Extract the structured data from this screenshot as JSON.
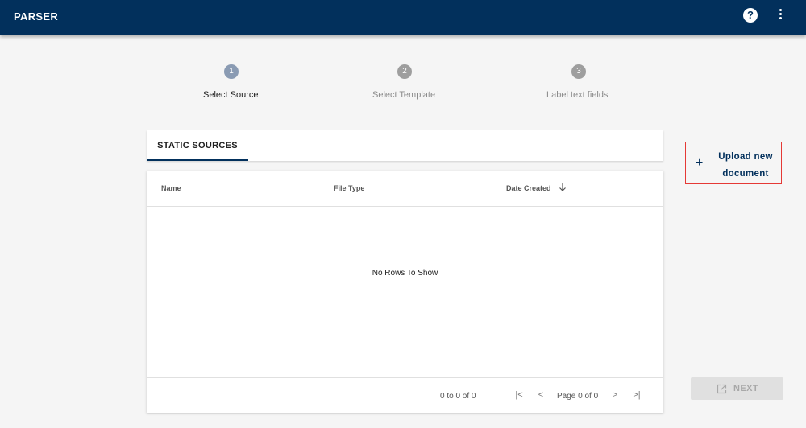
{
  "app": {
    "title": "PARSER",
    "help_glyph": "?",
    "help_icon": "help-icon",
    "menu_icon": "more-vert-icon"
  },
  "stepper": {
    "steps": [
      {
        "number": "1",
        "label": "Select Source",
        "state": "active"
      },
      {
        "number": "2",
        "label": "Select Template",
        "state": "inactive"
      },
      {
        "number": "3",
        "label": "Label text fields",
        "state": "inactive"
      }
    ]
  },
  "tabs": [
    {
      "label": "STATIC SOURCES",
      "selected": true
    }
  ],
  "grid": {
    "columns": [
      {
        "label": "Name"
      },
      {
        "label": "File Type"
      },
      {
        "label": "Date Created",
        "sort": "descending"
      }
    ],
    "rows": [],
    "empty_message": "No Rows To Show",
    "footer": {
      "row_count": "0 to 0 of 0",
      "page_info": "Page 0 of 0",
      "first_glyph": "|<",
      "prev_glyph": "<",
      "next_glyph": ">",
      "last_glyph": ">|"
    }
  },
  "upload": {
    "plus_glyph": "+",
    "label": "Upload new document",
    "icon": "plus-icon"
  },
  "next_button": {
    "label": "NEXT",
    "icon": "open-in-new-icon",
    "disabled": true
  },
  "colors": {
    "appbar": "#02305c",
    "accent": "#02305c",
    "highlight_border": "#e53935",
    "background": "#f5f5f5"
  }
}
